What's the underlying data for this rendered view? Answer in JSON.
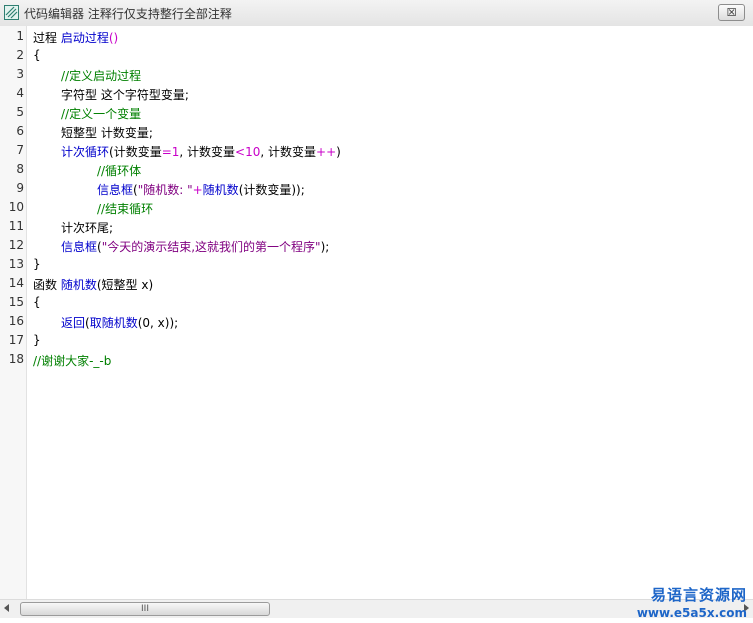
{
  "window": {
    "title": "代码编辑器 注释行仅支持整行全部注释",
    "close_label": "☒",
    "icon": "app-icon"
  },
  "colors": {
    "keyword": "#0000cc",
    "comment": "#008000",
    "string": "#800080",
    "operator": "#c800c8",
    "default": "#000000"
  },
  "lines": [
    {
      "n": "1",
      "indent": 0,
      "segments": [
        {
          "t": "过程 ",
          "c": "default"
        },
        {
          "t": "启动过程",
          "c": "keyword"
        },
        {
          "t": "()",
          "c": "op"
        }
      ]
    },
    {
      "n": "2",
      "indent": 0,
      "segments": [
        {
          "t": "{",
          "c": "default"
        }
      ]
    },
    {
      "n": "3",
      "indent": 1,
      "segments": [
        {
          "t": "//定义启动过程",
          "c": "comment"
        }
      ]
    },
    {
      "n": "4",
      "indent": 1,
      "segments": [
        {
          "t": "字符型 这个字符型变量;",
          "c": "default"
        }
      ]
    },
    {
      "n": "5",
      "indent": 1,
      "segments": [
        {
          "t": "//定义一个变量",
          "c": "comment"
        }
      ]
    },
    {
      "n": "6",
      "indent": 1,
      "segments": [
        {
          "t": "短整型 计数变量;",
          "c": "default"
        }
      ]
    },
    {
      "n": "7",
      "indent": 1,
      "segments": [
        {
          "t": "计次循环",
          "c": "keyword"
        },
        {
          "t": "(计数变量",
          "c": "default"
        },
        {
          "t": "=1",
          "c": "op"
        },
        {
          "t": ", 计数变量",
          "c": "default"
        },
        {
          "t": "<10",
          "c": "op"
        },
        {
          "t": ", 计数变量",
          "c": "default"
        },
        {
          "t": "++",
          "c": "op"
        },
        {
          "t": ")",
          "c": "default"
        }
      ]
    },
    {
      "n": "8",
      "indent": 2,
      "segments": [
        {
          "t": "//循环体",
          "c": "comment"
        }
      ]
    },
    {
      "n": "9",
      "indent": 2,
      "segments": [
        {
          "t": "信息框",
          "c": "keyword"
        },
        {
          "t": "(",
          "c": "default"
        },
        {
          "t": "\"随机数: \"",
          "c": "string"
        },
        {
          "t": "+",
          "c": "op"
        },
        {
          "t": "随机数",
          "c": "keyword"
        },
        {
          "t": "(计数变量));",
          "c": "default"
        }
      ]
    },
    {
      "n": "10",
      "indent": 2,
      "segments": [
        {
          "t": "//结束循环",
          "c": "comment"
        }
      ]
    },
    {
      "n": "11",
      "indent": 1,
      "segments": [
        {
          "t": "计次环尾;",
          "c": "default"
        }
      ]
    },
    {
      "n": "12",
      "indent": 1,
      "segments": [
        {
          "t": "信息框",
          "c": "keyword"
        },
        {
          "t": "(",
          "c": "default"
        },
        {
          "t": "\"今天的演示结束,这就我们的第一个程序\"",
          "c": "string"
        },
        {
          "t": ");",
          "c": "default"
        }
      ]
    },
    {
      "n": "13",
      "indent": 0,
      "segments": [
        {
          "t": "}",
          "c": "default"
        }
      ]
    },
    {
      "n": "14",
      "indent": 0,
      "segments": [
        {
          "t": "函数 ",
          "c": "default"
        },
        {
          "t": "随机数",
          "c": "keyword"
        },
        {
          "t": "(短整型 x)",
          "c": "default"
        }
      ]
    },
    {
      "n": "15",
      "indent": 0,
      "segments": [
        {
          "t": "{",
          "c": "default"
        }
      ]
    },
    {
      "n": "16",
      "indent": 1,
      "segments": [
        {
          "t": "返回",
          "c": "keyword"
        },
        {
          "t": "(",
          "c": "default"
        },
        {
          "t": "取随机数",
          "c": "keyword"
        },
        {
          "t": "(0, x));",
          "c": "default"
        }
      ]
    },
    {
      "n": "17",
      "indent": 0,
      "segments": [
        {
          "t": "}",
          "c": "default"
        }
      ]
    },
    {
      "n": "18",
      "indent": 0,
      "segments": [
        {
          "t": "//谢谢大家-_-b",
          "c": "comment"
        }
      ]
    }
  ],
  "scrollbar": {
    "grip": "III"
  },
  "watermark": {
    "name": "易语言资源网",
    "url": "www.e5a5x.com"
  }
}
